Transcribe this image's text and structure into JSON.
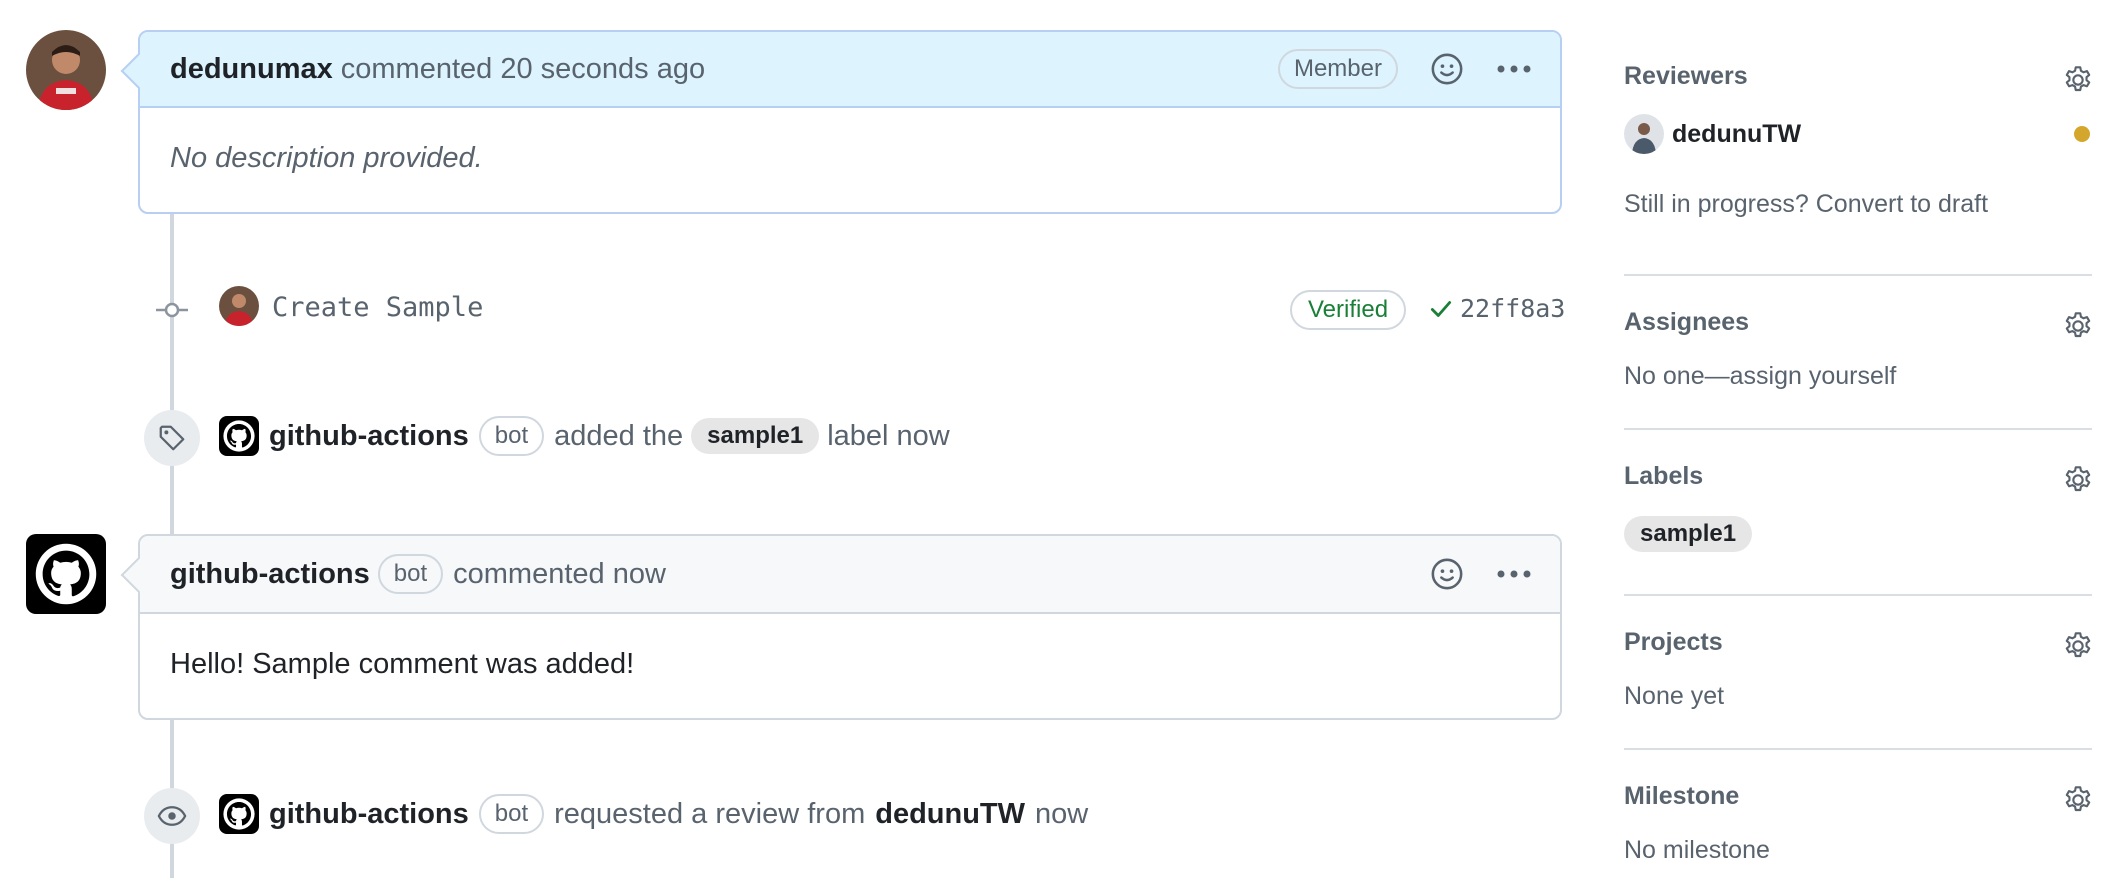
{
  "comment1": {
    "author": "dedunumax",
    "action": "commented 20 seconds ago",
    "badge": "Member",
    "body": "No description provided."
  },
  "commit": {
    "message": "Create Sample",
    "verified": "Verified",
    "sha": "22ff8a3"
  },
  "label_event": {
    "actor": "github-actions",
    "bot_badge": "bot",
    "text_before": "added the",
    "label": "sample1",
    "text_after": "label now"
  },
  "comment2": {
    "author": "github-actions",
    "bot_badge": "bot",
    "action": "commented now",
    "body": "Hello! Sample comment was added!"
  },
  "review_event": {
    "actor": "github-actions",
    "bot_badge": "bot",
    "text_before": "requested a review from",
    "reviewer": "dedunuTW",
    "text_after": "now"
  },
  "sidebar": {
    "reviewers": {
      "title": "Reviewers",
      "reviewer": "dedunuTW",
      "status_color": "#d4a72c",
      "draft_text": "Still in progress? Convert to draft"
    },
    "assignees": {
      "title": "Assignees",
      "value": "No one—assign yourself"
    },
    "labels": {
      "title": "Labels",
      "label": "sample1"
    },
    "projects": {
      "title": "Projects",
      "value": "None yet"
    },
    "milestone": {
      "title": "Milestone",
      "value": "No milestone"
    }
  },
  "colors": {
    "accent_header": "#ddf4ff",
    "verified_green": "#1a7f37"
  }
}
